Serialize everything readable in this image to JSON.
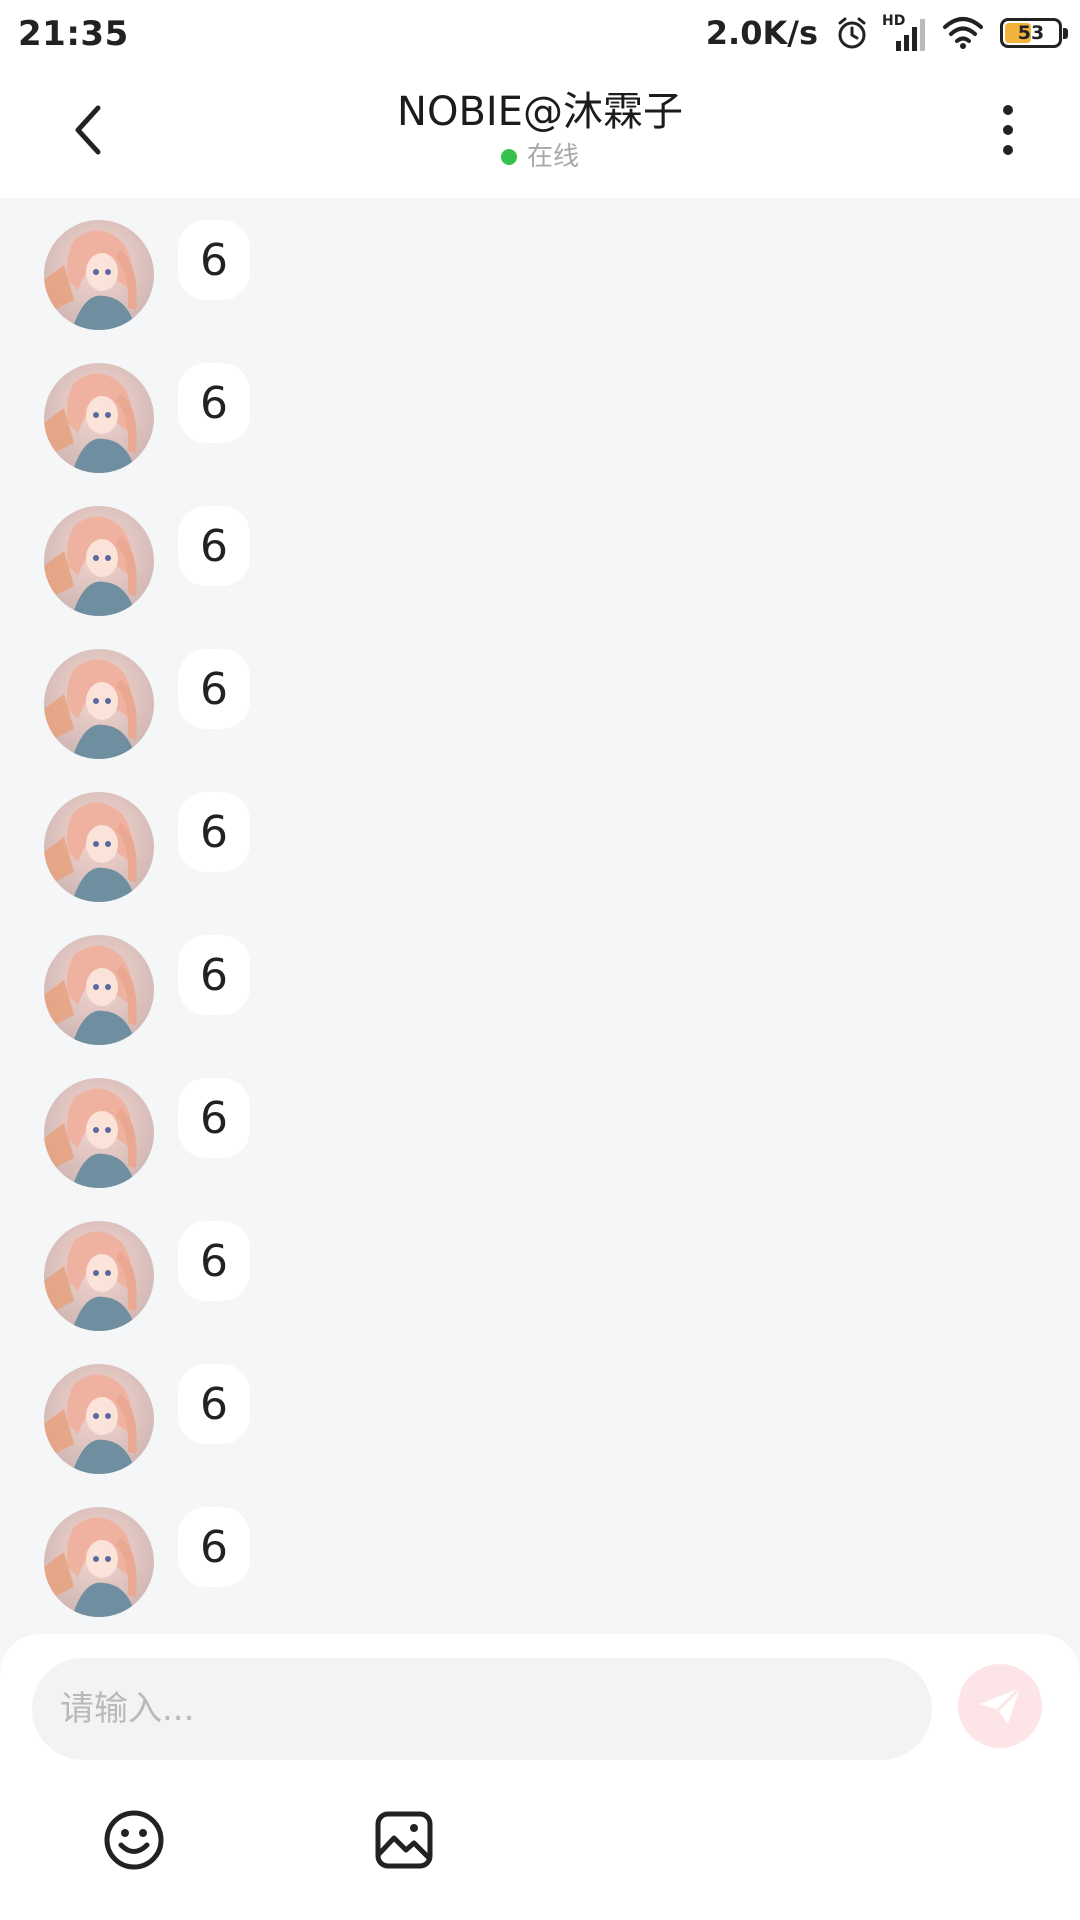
{
  "status_bar": {
    "time": "21:35",
    "net_speed": "2.0K/s",
    "hd_label": "HD",
    "battery_level": "53",
    "battery_fraction": 0.53,
    "icons": [
      "alarm-icon",
      "signal-icon",
      "wifi-icon",
      "battery-icon"
    ]
  },
  "header": {
    "title": "NOBIE@沐霖子",
    "status_text": "在线",
    "status_color": "#36c24a",
    "back_icon": "chevron-left-icon",
    "more_icon": "more-vertical-icon"
  },
  "messages": [
    {
      "sender": "other",
      "text": "6"
    },
    {
      "sender": "other",
      "text": "6"
    },
    {
      "sender": "other",
      "text": "6"
    },
    {
      "sender": "other",
      "text": "6"
    },
    {
      "sender": "other",
      "text": "6"
    },
    {
      "sender": "other",
      "text": "6"
    },
    {
      "sender": "other",
      "text": "6"
    },
    {
      "sender": "other",
      "text": "6"
    },
    {
      "sender": "other",
      "text": "6"
    },
    {
      "sender": "other",
      "text": "6"
    }
  ],
  "composer": {
    "placeholder": "请输入...",
    "value": "",
    "send_icon": "send-icon",
    "send_color": "#fde4e6",
    "tools": [
      "emoji-icon",
      "image-icon"
    ]
  },
  "colors": {
    "background": "#f5f6f8",
    "bubble": "#ffffff",
    "battery_fill": "#f2b33d"
  }
}
